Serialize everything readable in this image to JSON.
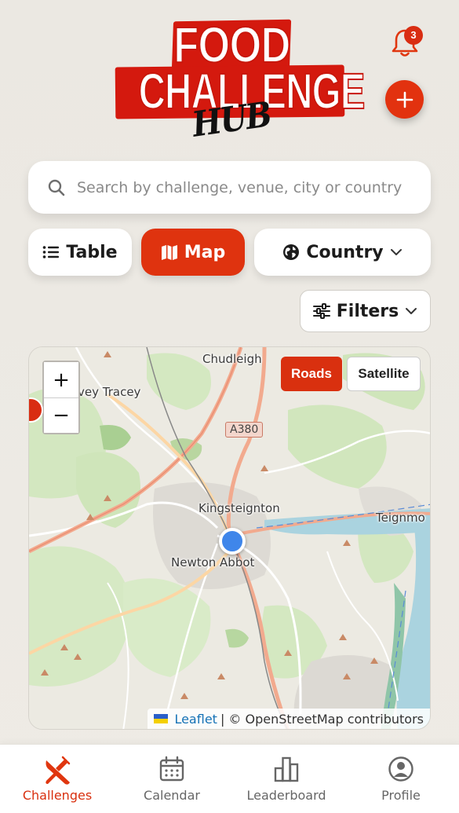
{
  "header": {
    "logo_line1": "FOOD",
    "logo_line2": "CHALLENGE",
    "logo_line3": "HUB",
    "notification_count": "3",
    "add_label": "+"
  },
  "search": {
    "placeholder": "Search by challenge, venue, city or country"
  },
  "view_controls": {
    "table_label": "Table",
    "map_label": "Map",
    "country_label": "Country",
    "filters_label": "Filters",
    "active": "map"
  },
  "map": {
    "zoom_in": "+",
    "zoom_out": "−",
    "layers": {
      "roads": "Roads",
      "satellite": "Satellite",
      "active": "roads"
    },
    "places": {
      "chudleigh": "Chudleigh",
      "bovey": "vey Tracey",
      "kingsteignton": "Kingsteignton",
      "newton_abbot": "Newton Abbot",
      "teignmouth": "Teignmo"
    },
    "road_label": "A380",
    "attribution": {
      "leaflet": "Leaflet",
      "rest": "| © OpenStreetMap contributors"
    }
  },
  "bottom_nav": {
    "items": [
      {
        "label": "Challenges",
        "icon": "utensils-crossed-icon",
        "active": true
      },
      {
        "label": "Calendar",
        "icon": "calendar-icon",
        "active": false
      },
      {
        "label": "Leaderboard",
        "icon": "bar-chart-icon",
        "active": false
      },
      {
        "label": "Profile",
        "icon": "user-circle-icon",
        "active": false
      }
    ]
  },
  "colors": {
    "accent": "#df330f",
    "background": "#ebe8e2",
    "location_dot": "#3f86ea"
  }
}
